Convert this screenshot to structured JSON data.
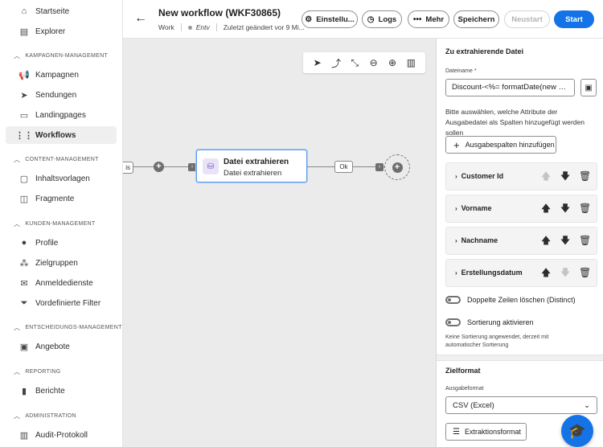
{
  "sidebar": {
    "items_top": [
      {
        "label": "Startseite",
        "icon": "home-icon"
      },
      {
        "label": "Explorer",
        "icon": "explorer-icon"
      }
    ],
    "sections": [
      {
        "title": "KAMPAGNEN-MANAGEMENT",
        "items": [
          {
            "label": "Kampagnen",
            "icon": "megaphone-icon"
          },
          {
            "label": "Sendungen",
            "icon": "send-icon"
          },
          {
            "label": "Landingpages",
            "icon": "page-icon"
          },
          {
            "label": "Workflows",
            "icon": "workflow-icon",
            "active": true
          }
        ]
      },
      {
        "title": "CONTENT-MANAGEMENT",
        "items": [
          {
            "label": "Inhaltsvorlagen",
            "icon": "template-icon"
          },
          {
            "label": "Fragmente",
            "icon": "fragment-icon"
          }
        ]
      },
      {
        "title": "KUNDEN-MANAGEMENT",
        "items": [
          {
            "label": "Profile",
            "icon": "profile-icon"
          },
          {
            "label": "Zielgruppen",
            "icon": "audience-icon"
          },
          {
            "label": "Anmeldedienste",
            "icon": "subscription-icon"
          },
          {
            "label": "Vordefinierte Filter",
            "icon": "filter-icon"
          }
        ]
      },
      {
        "title": "ENTSCHEIDUNGS-MANAGEMENT",
        "items": [
          {
            "label": "Angebote",
            "icon": "offer-icon"
          }
        ]
      },
      {
        "title": "REPORTING",
        "items": [
          {
            "label": "Berichte",
            "icon": "chart-icon"
          }
        ]
      },
      {
        "title": "ADMINISTRATION",
        "items": [
          {
            "label": "Audit-Protokoll",
            "icon": "audit-icon"
          }
        ]
      }
    ]
  },
  "header": {
    "title": "New workflow (WKF30865)",
    "meta_work": "Work",
    "meta_status": "Entv",
    "meta_modified": "Zuletzt geändert vor 9 Mi...",
    "buttons": {
      "settings": "Einstellu...",
      "logs": "Logs",
      "more": "Mehr",
      "save": "Speichern",
      "restart": "Neustart",
      "start": "Start"
    }
  },
  "canvas": {
    "prev_node_label": "is",
    "activity_title": "Datei extrahieren",
    "activity_subtitle": "Datei extrahieren",
    "ok_label": "Ok"
  },
  "panel": {
    "section_title": "Zu extrahierende Datei",
    "filename_label": "Dateiname",
    "filename_value": "Discount-<%= formatDate(new D...",
    "help_text": "Bitte auswählen, welche Attribute der Ausgabedatei als Spalten hinzugefügt werden  sollen",
    "add_columns_label": "Ausgabespalten hinzufügen",
    "columns": [
      {
        "name": "Customer Id",
        "up_enabled": false,
        "down_enabled": true
      },
      {
        "name": "Vorname",
        "up_enabled": true,
        "down_enabled": true
      },
      {
        "name": "Nachname",
        "up_enabled": true,
        "down_enabled": true
      },
      {
        "name": "Erstellungsdatum",
        "up_enabled": true,
        "down_enabled": false
      }
    ],
    "distinct_label": "Doppelte Zeilen löschen (Distinct)",
    "sort_label": "Sortierung aktivieren",
    "sort_note": "Keine Sortierung angewendet, derzeit mit automatischer Sortierung",
    "format_section_title": "Zielformat",
    "output_format_label": "Ausgabeformat",
    "output_format_value": "CSV (Excel)",
    "extraction_format_label": "Extraktionsformat"
  },
  "colors": {
    "primary": "#1473e6",
    "activity_icon": "#7a4fcf"
  }
}
